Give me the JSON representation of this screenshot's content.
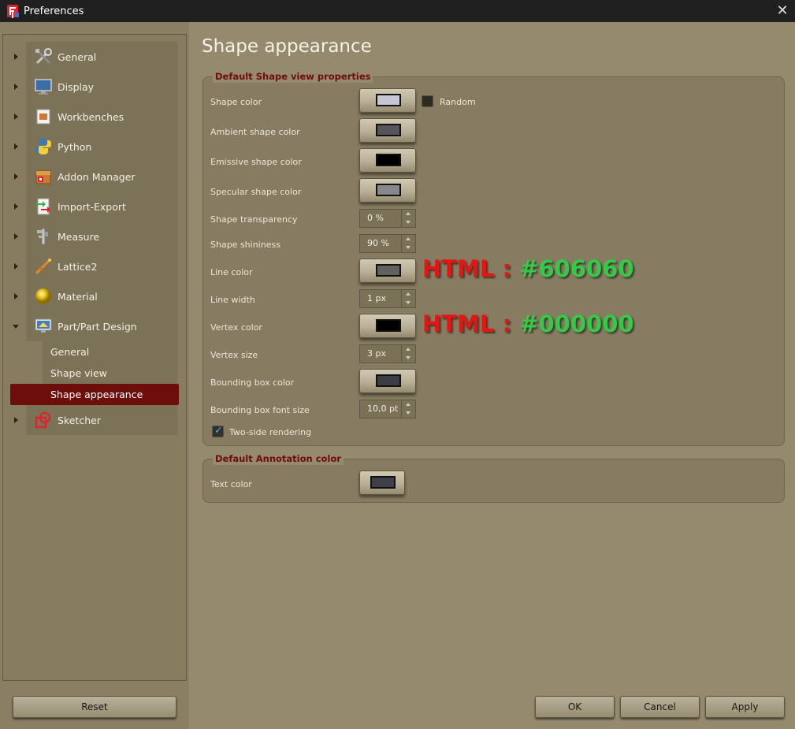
{
  "window": {
    "title": "Preferences"
  },
  "sidebar": {
    "items": [
      {
        "label": "General",
        "icon": "tools-icon"
      },
      {
        "label": "Display",
        "icon": "monitor-icon"
      },
      {
        "label": "Workbenches",
        "icon": "workbench-icon"
      },
      {
        "label": "Python",
        "icon": "python-icon"
      },
      {
        "label": "Addon Manager",
        "icon": "addon-icon"
      },
      {
        "label": "Import-Export",
        "icon": "import-export-icon"
      },
      {
        "label": "Measure",
        "icon": "caliper-icon"
      },
      {
        "label": "Lattice2",
        "icon": "lattice-icon"
      },
      {
        "label": "Material",
        "icon": "material-sphere-icon"
      },
      {
        "label": "Part/Part Design",
        "icon": "part-design-icon",
        "expanded": true
      },
      {
        "label": "Sketcher",
        "icon": "sketcher-icon"
      }
    ],
    "sub_items": [
      "General",
      "Shape view",
      "Shape appearance"
    ],
    "selected": "Shape appearance"
  },
  "buttons": {
    "reset": "Reset",
    "ok": "OK",
    "cancel": "Cancel",
    "apply": "Apply"
  },
  "main": {
    "title": "Shape appearance",
    "shape_group": {
      "title": "Default Shape view properties",
      "shape_color": {
        "label": "Shape color",
        "color": "#c5c5d3"
      },
      "random": {
        "label": "Random",
        "checked": false
      },
      "ambient_color": {
        "label": "Ambient shape color",
        "color": "#55555a"
      },
      "emissive_color": {
        "label": "Emissive shape color",
        "color": "#000000"
      },
      "specular_color": {
        "label": "Specular shape color",
        "color": "#88888c"
      },
      "transparency": {
        "label": "Shape transparency",
        "value": "0 %"
      },
      "shininess": {
        "label": "Shape shininess",
        "value": "90 %"
      },
      "line_color": {
        "label": "Line color",
        "color": "#606060"
      },
      "line_width": {
        "label": "Line width",
        "value": "1 px"
      },
      "vertex_color": {
        "label": "Vertex color",
        "color": "#000000"
      },
      "vertex_size": {
        "label": "Vertex size",
        "value": "3 px"
      },
      "bbox_color": {
        "label": "Bounding box color",
        "color": "#3c3c44"
      },
      "bbox_font_size": {
        "label": "Bounding box font size",
        "value": "10,0 pt"
      },
      "two_side": {
        "label": "Two-side rendering",
        "checked": true
      }
    },
    "annotation_group": {
      "title": "Default Annotation color",
      "text_color": {
        "label": "Text color",
        "color": "#3e3f48"
      }
    }
  },
  "annotations": {
    "line_color_note": {
      "prefix": "HTML : ",
      "value": "#606060"
    },
    "vertex_color_note": {
      "prefix": "HTML : ",
      "value": "#000000"
    }
  }
}
